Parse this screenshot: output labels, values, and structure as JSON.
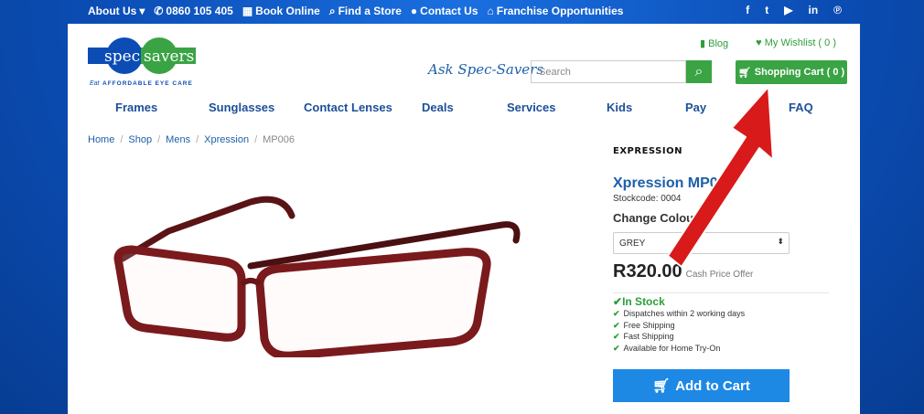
{
  "topbar": {
    "about": "About Us",
    "phone": "0860 105 405",
    "book": "Book Online",
    "find": "Find a Store",
    "contact": "Contact Us",
    "franchise": "Franchise Opportunities",
    "social": [
      "f",
      "t",
      "yt",
      "in",
      "p"
    ]
  },
  "header": {
    "logo_text_left": "spec",
    "logo_text_right": "savers",
    "logo_tagline": "AFFORDABLE EYE CARE",
    "logo_tag_prefix": "Eat",
    "blog": "Blog",
    "wishlist": "My Wishlist ( 0 )",
    "ask": "Ask Spec-Savers",
    "search_placeholder": "Search",
    "cart": "Shopping Cart ( 0 )"
  },
  "nav": [
    "Frames",
    "Sunglasses",
    "Contact Lenses",
    "Deals",
    "Services",
    "Kids",
    "Pay",
    "FAQ"
  ],
  "breadcrumb": [
    "Home",
    "Shop",
    "Mens",
    "Xpression",
    "MP006"
  ],
  "product": {
    "brand": "EXPRESSION",
    "title": "Xpression MP006",
    "stockcode": "Stockcode: 0004",
    "change_colour": "Change Colour",
    "colour": "GREY",
    "price": "R320.00",
    "price_note": "Cash Price Offer",
    "in_stock": "In Stock",
    "features": [
      "Dispatches within 2 working days",
      "Free Shipping",
      "Fast Shipping",
      "Available for Home Try-On"
    ],
    "add_to_cart": "Add to Cart"
  },
  "colors": {
    "accent_green": "#3aa344",
    "brand_blue": "#1d5fa8",
    "button_blue": "#1e88e5",
    "arrow_red": "#d81a1a"
  }
}
